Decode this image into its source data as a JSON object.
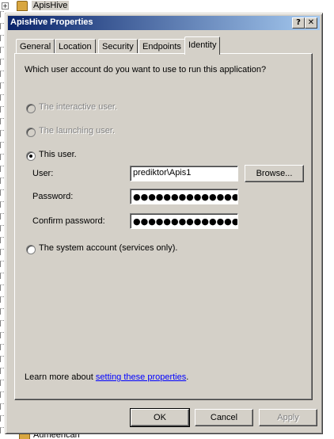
{
  "tree": {
    "top_item": "ApisHive",
    "expander": "+",
    "bottom_item": "Aumeencan"
  },
  "dialog": {
    "title": "ApisHive Properties",
    "help_glyph": "?",
    "close_glyph": "✕"
  },
  "tabs": [
    {
      "label": "General"
    },
    {
      "label": "Location"
    },
    {
      "label": "Security"
    },
    {
      "label": "Endpoints"
    },
    {
      "label": "Identity"
    }
  ],
  "identity": {
    "question": "Which user account do you want to use to run this application?",
    "option_interactive": "The interactive user.",
    "option_launching": "The launching user.",
    "option_this_user": "This user.",
    "option_system": "The system account (services only).",
    "selected_option": "This user.",
    "user_label": "User:",
    "user_value": "prediktor\\Apis1",
    "browse_label": "Browse...",
    "password_label": "Password:",
    "password_value": "●●●●●●●●●●●●●●●",
    "confirm_label": "Confirm password:",
    "confirm_value": "●●●●●●●●●●●●●●●",
    "learn_prefix": "Learn more about ",
    "learn_link": "setting these properties",
    "learn_suffix": "."
  },
  "buttons": {
    "ok": "OK",
    "cancel": "Cancel",
    "apply": "Apply"
  }
}
